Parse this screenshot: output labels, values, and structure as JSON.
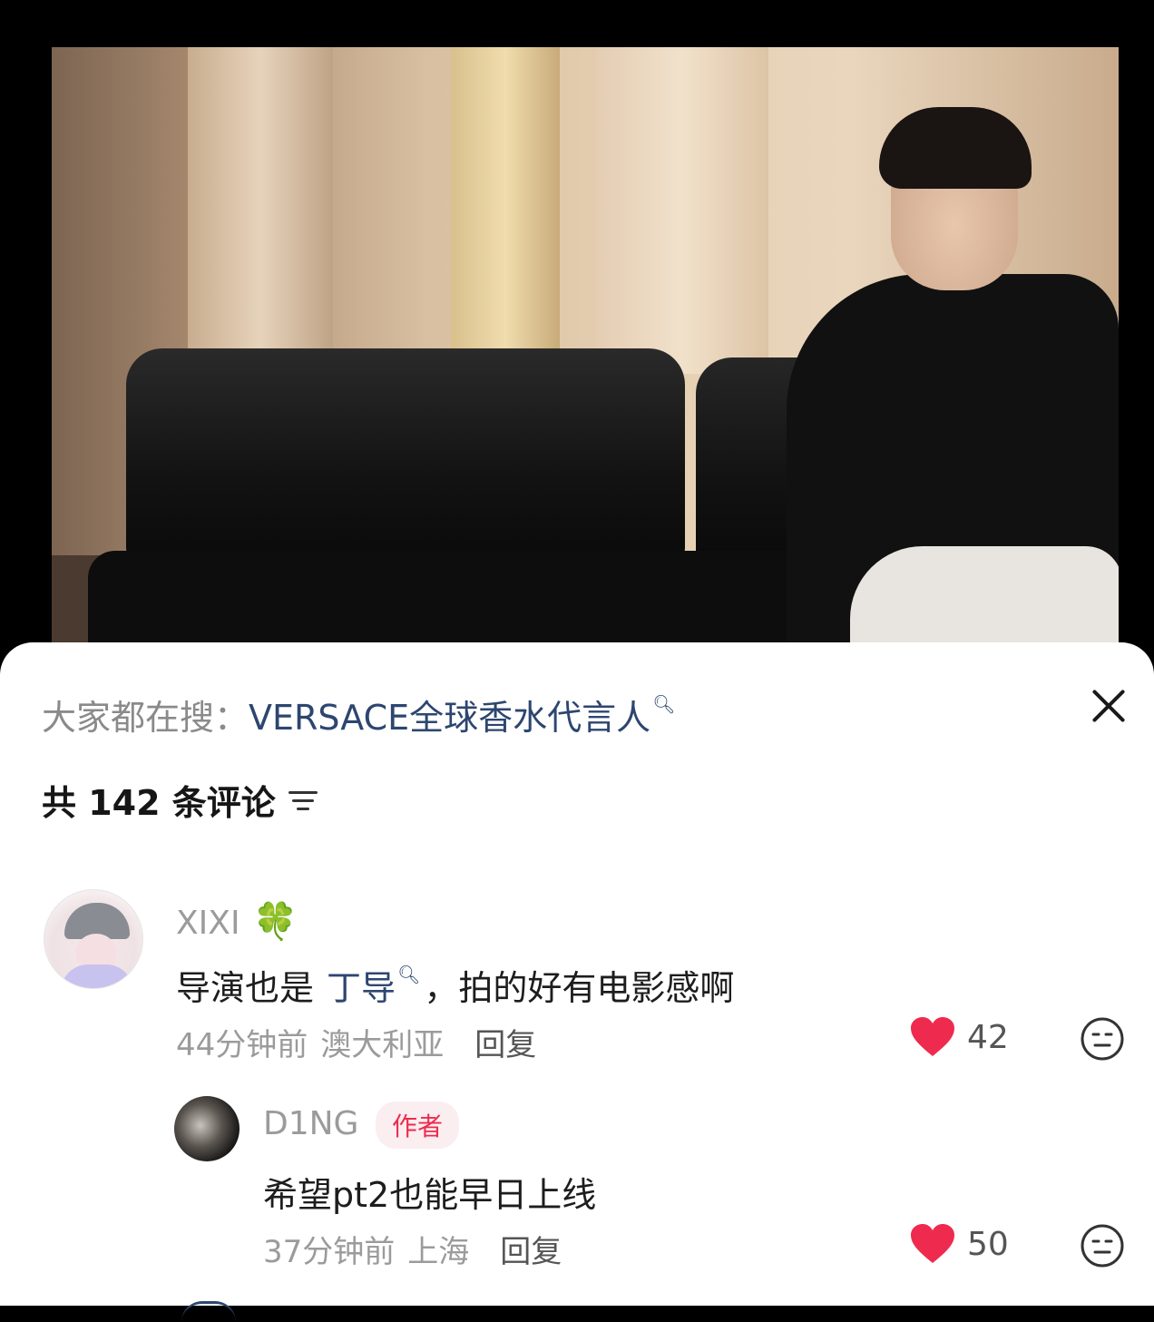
{
  "search": {
    "prefix": "大家都在搜：",
    "keyword": "VERSACE全球香水代言人"
  },
  "comments_header": {
    "count_text": "共 142 条评论"
  },
  "comments": [
    {
      "username": "XIXI",
      "badge_emoji": "🍀",
      "text_before": "导演也是",
      "mention": "丁导",
      "text_after": "，拍的好有电影感啊",
      "time": "44分钟前",
      "location": "澳大利亚",
      "reply_label": "回复",
      "likes": "42"
    },
    {
      "username": "D1NG",
      "author_badge": "作者",
      "text": "希望pt2也能早日上线",
      "time": "37分钟前",
      "location": "上海",
      "reply_label": "回复",
      "likes": "50"
    }
  ],
  "colors": {
    "keyword": "#2d4670",
    "like_heart": "#ee2b4e",
    "author_badge_text": "#ee2b4e"
  }
}
